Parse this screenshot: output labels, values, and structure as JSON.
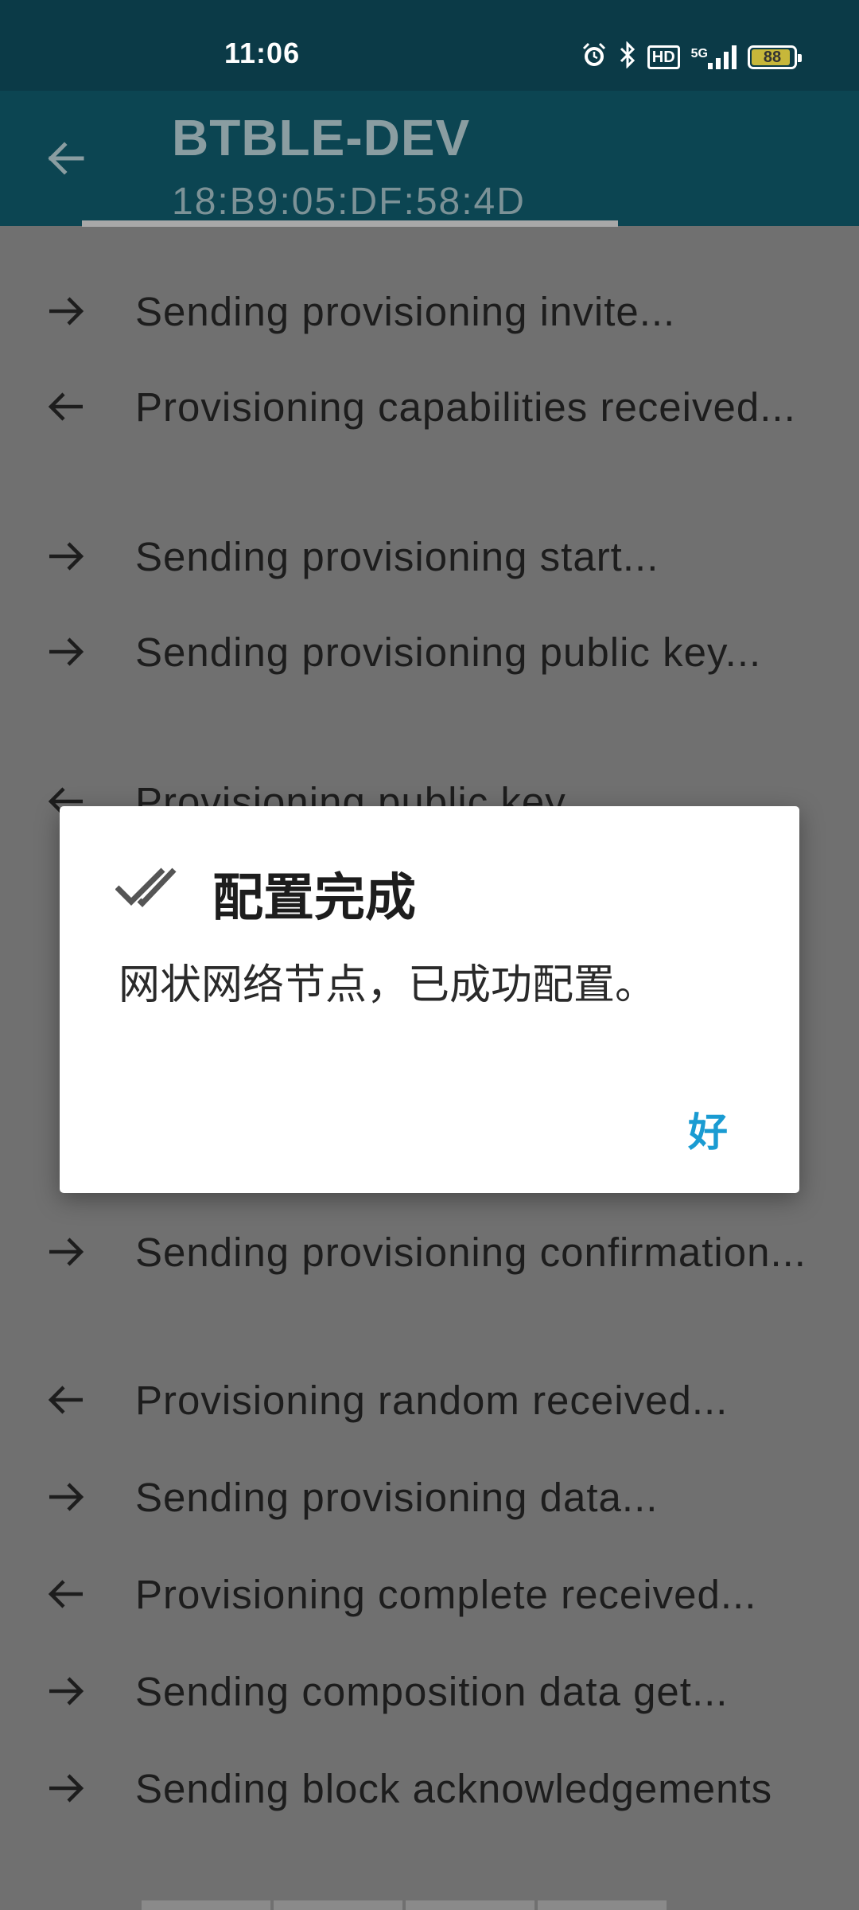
{
  "status_bar": {
    "time": "11:06",
    "icons": [
      "alarm-icon",
      "bluetooth-icon",
      "hd-icon",
      "5g-signal-icon",
      "battery-icon"
    ],
    "hd_label": "HD",
    "network_label": "5G",
    "battery_level": "88"
  },
  "app_bar": {
    "title": "BTBLE-DEV",
    "subtitle": "18:B9:05:DF:58:4D",
    "back_icon": "arrow-back-icon"
  },
  "log": [
    {
      "direction": "outgoing",
      "icon": "arrow-right-icon",
      "text": "Sending provisioning invite..."
    },
    {
      "direction": "incoming",
      "icon": "arrow-left-icon",
      "text": "Provisioning capabilities received..."
    },
    {
      "direction": "outgoing",
      "icon": "arrow-right-icon",
      "text": "Sending provisioning start..."
    },
    {
      "direction": "outgoing",
      "icon": "arrow-right-icon",
      "text": "Sending provisioning public key..."
    },
    {
      "direction": "incoming",
      "icon": "arrow-left-icon",
      "text": "Provisioning public key..."
    },
    {
      "direction": "outgoing",
      "icon": "arrow-right-icon",
      "text": "Sending provisioning confirmation..."
    },
    {
      "direction": "incoming",
      "icon": "arrow-left-icon",
      "text": "Provisioning random received..."
    },
    {
      "direction": "outgoing",
      "icon": "arrow-right-icon",
      "text": "Sending provisioning data..."
    },
    {
      "direction": "incoming",
      "icon": "arrow-left-icon",
      "text": "Provisioning complete received..."
    },
    {
      "direction": "outgoing",
      "icon": "arrow-right-icon",
      "text": "Sending composition data get..."
    },
    {
      "direction": "outgoing",
      "icon": "arrow-right-icon",
      "text": "Sending block acknowledgements"
    }
  ],
  "dialog": {
    "icon": "double-check-icon",
    "title": "配置完成",
    "message": "网状网络节点，已成功配置。",
    "ok_label": "好"
  },
  "colors": {
    "status_bar": "#0b3a47",
    "app_bar": "#0c4552",
    "scrim_background": "#707070",
    "dialog_accent": "#1a9bd2"
  }
}
